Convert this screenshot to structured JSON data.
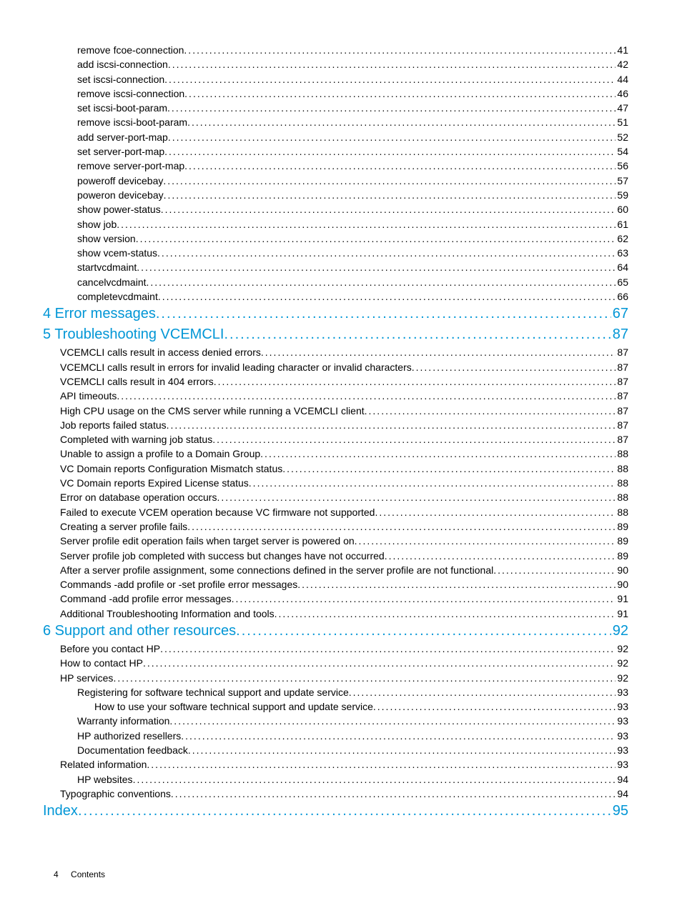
{
  "toc": [
    {
      "level": 2,
      "label": "remove fcoe-connection",
      "page": "41"
    },
    {
      "level": 2,
      "label": "add iscsi-connection",
      "page": "42"
    },
    {
      "level": 2,
      "label": "set iscsi-connection",
      "page": "44"
    },
    {
      "level": 2,
      "label": "remove iscsi-connection",
      "page": "46"
    },
    {
      "level": 2,
      "label": "set iscsi-boot-param",
      "page": "47"
    },
    {
      "level": 2,
      "label": "remove iscsi-boot-param",
      "page": "51"
    },
    {
      "level": 2,
      "label": "add server-port-map",
      "page": "52"
    },
    {
      "level": 2,
      "label": "set server-port-map",
      "page": "54"
    },
    {
      "level": 2,
      "label": "remove server-port-map",
      "page": "56"
    },
    {
      "level": 2,
      "label": "poweroff devicebay",
      "page": "57"
    },
    {
      "level": 2,
      "label": "poweron devicebay",
      "page": "59"
    },
    {
      "level": 2,
      "label": "show power-status",
      "page": "60"
    },
    {
      "level": 2,
      "label": "show job",
      "page": "61"
    },
    {
      "level": 2,
      "label": "show version",
      "page": "62"
    },
    {
      "level": 2,
      "label": "show vcem-status",
      "page": "63"
    },
    {
      "level": 2,
      "label": "startvcdmaint",
      "page": "64"
    },
    {
      "level": 2,
      "label": "cancelvcdmaint",
      "page": "65"
    },
    {
      "level": 2,
      "label": "completevcdmaint",
      "page": "66"
    },
    {
      "level": "chapter",
      "label": "4 Error messages",
      "page": "67"
    },
    {
      "level": "chapter",
      "label": "5 Troubleshooting VCEMCLI",
      "page": "87"
    },
    {
      "level": 1,
      "label": "VCEMCLI calls result in access denied errors",
      "page": "87"
    },
    {
      "level": 1,
      "label": "VCEMCLI calls result in errors for invalid leading character or invalid characters",
      "page": "87"
    },
    {
      "level": 1,
      "label": "VCEMCLI calls result in 404 errors",
      "page": "87"
    },
    {
      "level": 1,
      "label": "API timeouts",
      "page": "87"
    },
    {
      "level": 1,
      "label": "High CPU usage on the CMS server while running a VCEMCLI client",
      "page": "87"
    },
    {
      "level": 1,
      "label": "Job reports failed status",
      "page": "87"
    },
    {
      "level": 1,
      "label": "Completed with warning job status",
      "page": "87"
    },
    {
      "level": 1,
      "label": "Unable to assign a profile to a Domain Group",
      "page": "88"
    },
    {
      "level": 1,
      "label": "VC Domain reports Configuration Mismatch status",
      "page": "88"
    },
    {
      "level": 1,
      "label": "VC Domain reports Expired License status",
      "page": "88"
    },
    {
      "level": 1,
      "label": "Error on database operation occurs",
      "page": "88"
    },
    {
      "level": 1,
      "label": "Failed to execute VCEM operation because VC firmware not supported",
      "page": "88"
    },
    {
      "level": 1,
      "label": "Creating a server profile fails",
      "page": "89"
    },
    {
      "level": 1,
      "label": "Server profile edit operation fails when target server is powered on",
      "page": "89"
    },
    {
      "level": 1,
      "label": "Server profile job completed with success but changes have not occurred",
      "page": "89"
    },
    {
      "level": 1,
      "label": "After a server profile assignment, some connections defined in the server profile are not functional",
      "page": "90"
    },
    {
      "level": 1,
      "label": "Commands -add profile or -set profile error messages",
      "page": "90"
    },
    {
      "level": 1,
      "label": "Command -add profile error messages",
      "page": "91"
    },
    {
      "level": 1,
      "label": "Additional Troubleshooting Information and tools",
      "page": "91"
    },
    {
      "level": "chapter",
      "label": "6 Support and other resources",
      "page": "92"
    },
    {
      "level": 1,
      "label": "Before you contact HP",
      "page": "92"
    },
    {
      "level": 1,
      "label": "How to contact HP",
      "page": "92"
    },
    {
      "level": 1,
      "label": "HP services",
      "page": "92"
    },
    {
      "level": 2,
      "label": "Registering for software technical support and update service",
      "page": "93"
    },
    {
      "level": 3,
      "label": "How to use your software technical support and update service",
      "page": "93"
    },
    {
      "level": 2,
      "label": "Warranty information",
      "page": "93"
    },
    {
      "level": 2,
      "label": "HP authorized resellers",
      "page": "93"
    },
    {
      "level": 2,
      "label": "Documentation feedback",
      "page": "93"
    },
    {
      "level": 1,
      "label": "Related information",
      "page": "93"
    },
    {
      "level": 2,
      "label": "HP websites",
      "page": "94"
    },
    {
      "level": 1,
      "label": "Typographic conventions",
      "page": "94"
    },
    {
      "level": "chapter",
      "label": "Index",
      "page": "95"
    }
  ],
  "footer": {
    "pagenum": "4",
    "section": "Contents"
  }
}
